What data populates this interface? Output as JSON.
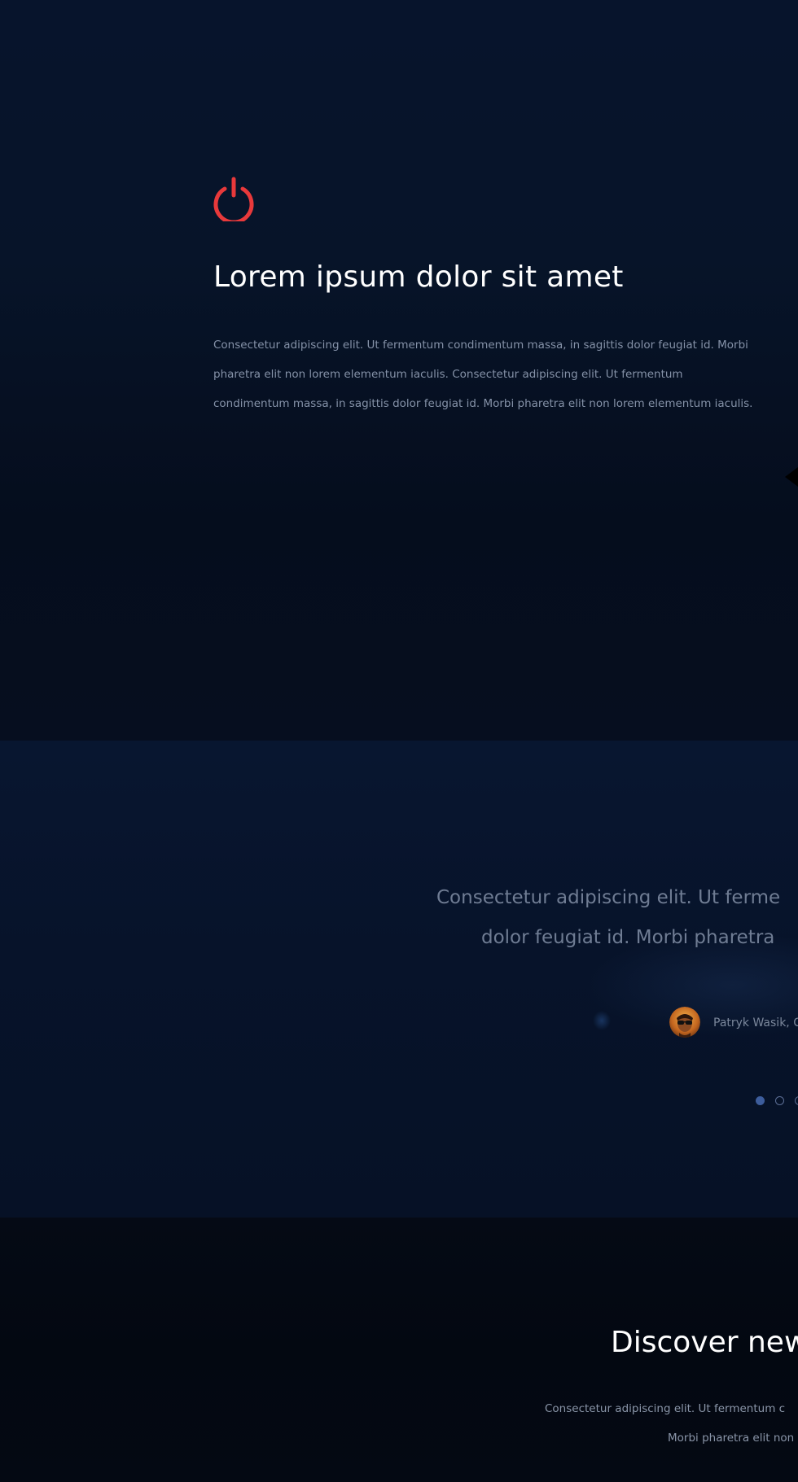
{
  "feature": {
    "icon": "power-icon",
    "icon_color": "#e8393b",
    "title": "Lorem ipsum dolor sit amet",
    "body": "Consectetur adipiscing elit. Ut fermentum condimentum massa, in sagittis dolor feugiat id. Morbi pharetra elit non lorem elementum iaculis. Consectetur adipiscing elit. Ut fermentum condimentum massa, in sagittis dolor feugiat id. Morbi pharetra elit non lorem elementum iaculis."
  },
  "testimonial": {
    "quote_line_1": "Consectetur adipiscing elit. Ut ferme",
    "quote_line_2": "dolor feugiat id. Morbi pharetra",
    "author": "Patryk Wasik, C",
    "dots": [
      {
        "active": true
      },
      {
        "active": false
      },
      {
        "active": false
      }
    ],
    "accent_color": "#3d5d9c"
  },
  "discover": {
    "title": "Discover new",
    "line_1": "Consectetur adipiscing elit. Ut fermentum c",
    "line_2": "Morbi pharetra elit non"
  }
}
